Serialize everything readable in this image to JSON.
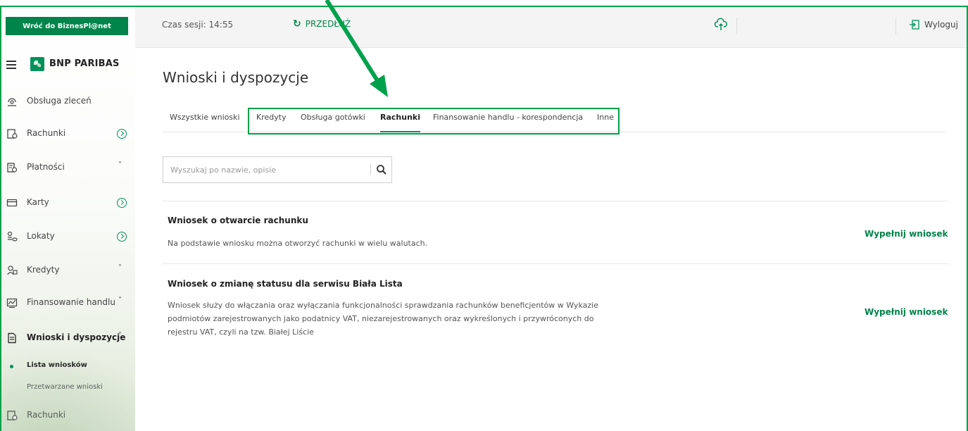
{
  "sidebar": {
    "back_label": "Wróć do BiznesPl@net",
    "brand": "BNP PARIBAS",
    "items": [
      {
        "label": "Obsługa zleceń",
        "icon": "service-icon"
      },
      {
        "label": "Rachunki",
        "icon": "account-icon",
        "badge": true
      },
      {
        "label": "Płatności",
        "icon": "payments-icon",
        "chevron": "˅"
      },
      {
        "label": "Karty",
        "icon": "card-icon",
        "badge": true
      },
      {
        "label": "Lokaty",
        "icon": "deposit-icon",
        "badge": true
      },
      {
        "label": "Kredyty",
        "icon": "credit-icon",
        "chevron": "˅"
      },
      {
        "label": "Finansowanie handlu",
        "icon": "trade-finance-icon",
        "chevron": "˅"
      },
      {
        "label": "Wnioski i dyspozycje",
        "icon": "document-icon",
        "chevron": "˄",
        "active": true
      },
      {
        "label": "Rachunki",
        "icon": "account-icon"
      }
    ],
    "subitems": [
      {
        "label": "Lista wniosków",
        "active": true
      },
      {
        "label": "Przetwarzane wnioski",
        "active": false
      }
    ]
  },
  "topbar": {
    "session": "Czas sesji: 14:55",
    "extend": "PRZEDŁUŻ",
    "logout": "Wyloguj"
  },
  "main": {
    "title": "Wnioski i dyspozycje",
    "tabs": [
      {
        "label": "Wszystkie wnioski"
      },
      {
        "label": "Kredyty"
      },
      {
        "label": "Obsługa gotówki"
      },
      {
        "label": "Rachunki",
        "active": true
      },
      {
        "label": "Finansowanie handlu - korespondencja"
      },
      {
        "label": "Inne"
      }
    ],
    "search_placeholder": "Wyszukaj po nazwie, opisie",
    "requests": [
      {
        "title": "Wniosek o otwarcie rachunku",
        "description": "Na podstawie wniosku można otworzyć rachunki w wielu walutach.",
        "action": "Wypełnij wniosek"
      },
      {
        "title": "Wniosek o zmianę statusu dla serwisu Biała Lista",
        "description": "Wniosek służy do włączania oraz wyłączania funkcjonalności sprawdzania rachunków beneficjentów w Wykazie podmiotów zarejestrowanych jako podatnicy VAT, niezarejestrowanych oraz wykreślonych i przywróconych do rejestru VAT, czyli na tzw. Białej Liście",
        "action": "Wypełnij wniosek"
      }
    ]
  },
  "colors": {
    "brand_green": "#00915a",
    "highlight_green": "#00a14b",
    "link_green": "#00844a"
  }
}
